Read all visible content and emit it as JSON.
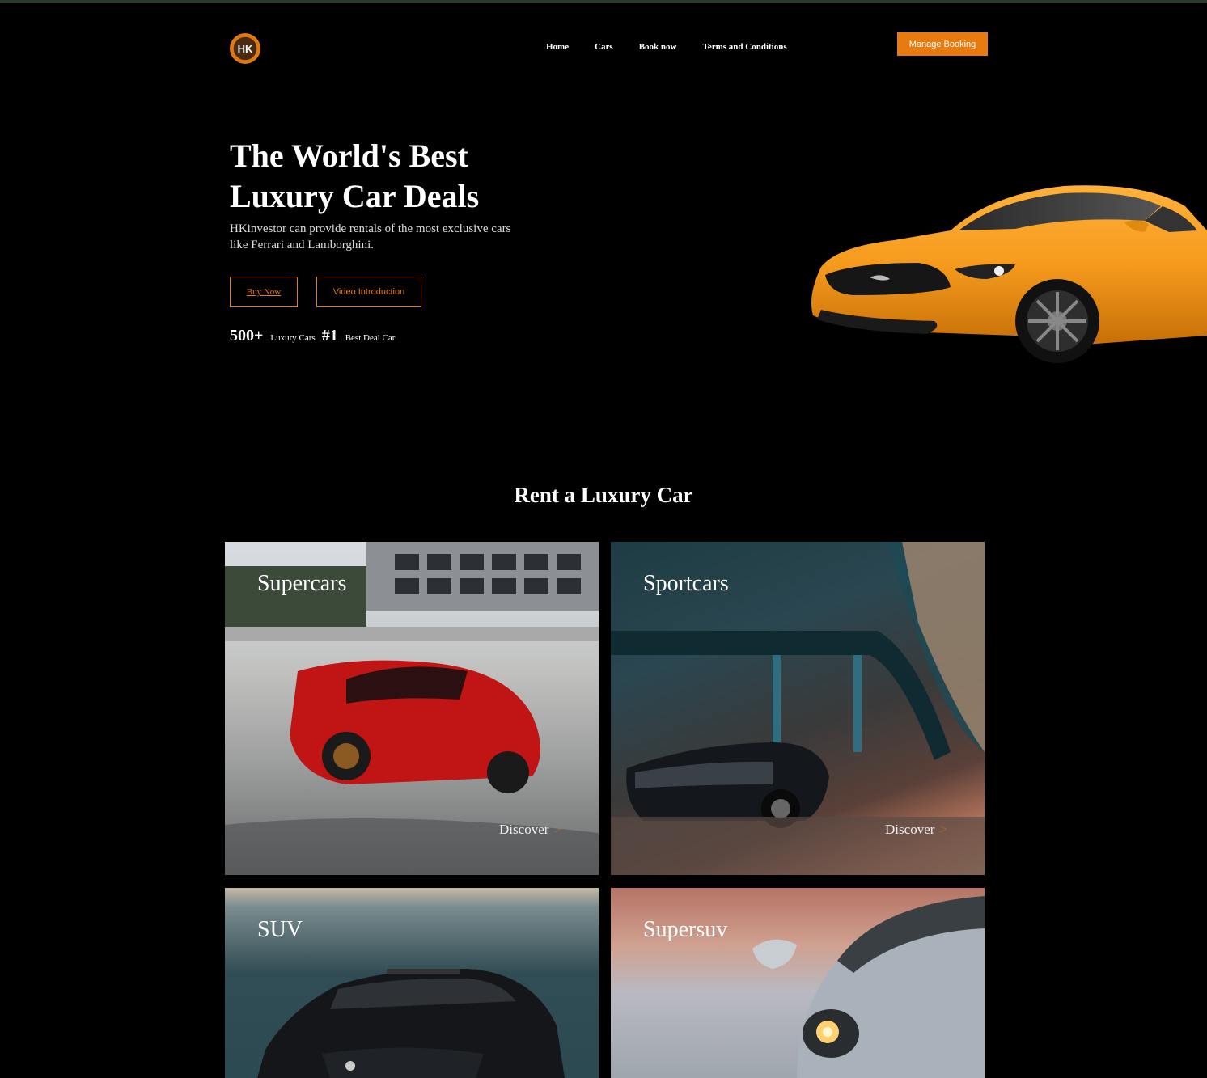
{
  "brand": {
    "logo_text": "HK"
  },
  "nav": {
    "items": [
      "Home",
      "Cars",
      "Book now",
      "Terms and Conditions"
    ],
    "manage_booking": "Manage Booking"
  },
  "hero": {
    "title_line1": "The World's Best",
    "title_line2": "Luxury Car Deals",
    "subtitle": "HKinvestor can provide rentals of the most exclusive cars like Ferrari and Lamborghini.",
    "buy_now": "Buy Now",
    "video_intro": "Video Introduction",
    "stats": [
      {
        "number": "500+",
        "label": "Luxury Cars"
      },
      {
        "number": "#1",
        "label": "Best Deal Car"
      }
    ]
  },
  "section": {
    "title": "Rent a Luxury Car",
    "cards": [
      {
        "label": "Supercars",
        "action": "Discover"
      },
      {
        "label": "Sportcars",
        "action": "Discover"
      },
      {
        "label": "SUV"
      },
      {
        "label": "Supersuv"
      }
    ]
  },
  "colors": {
    "accent": "#e87b10",
    "background": "#000000",
    "text": "#ffffff"
  }
}
